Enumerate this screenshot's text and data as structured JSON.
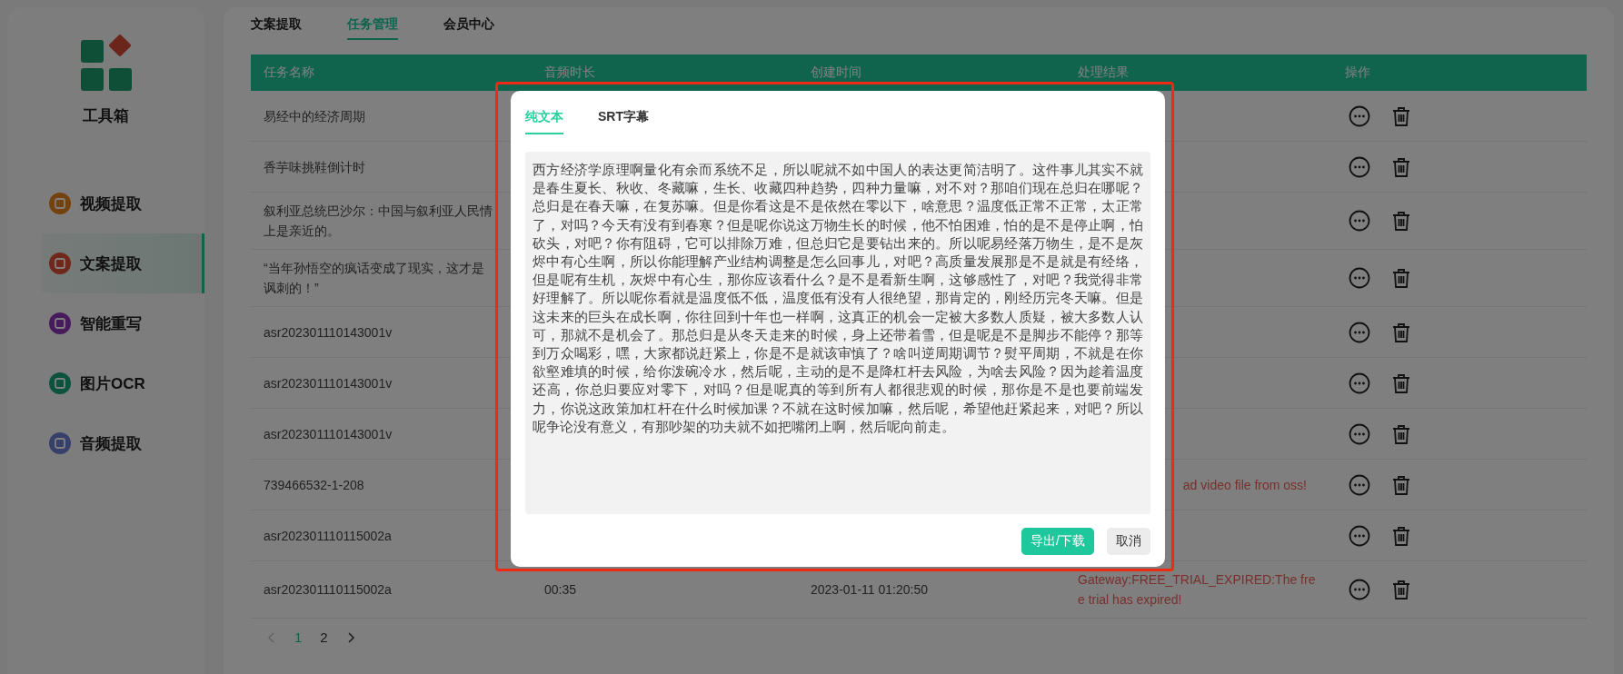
{
  "sidebar": {
    "app_name": "工具箱",
    "items": [
      {
        "label": "视频提取",
        "selected": false,
        "color": "#74420d"
      },
      {
        "label": "文案提取",
        "selected": true,
        "color": "#70281a"
      },
      {
        "label": "智能重写",
        "selected": false,
        "color": "#471a5c"
      },
      {
        "label": "图片OCR",
        "selected": false,
        "color": "#0d523d"
      },
      {
        "label": "音频提取",
        "selected": false,
        "color": "#36406b"
      }
    ]
  },
  "tabs": [
    {
      "label": "文案提取",
      "selected": false
    },
    {
      "label": "任务管理",
      "selected": true
    },
    {
      "label": "会员中心",
      "selected": false
    }
  ],
  "table": {
    "columns": [
      "任务名称",
      "音频时长",
      "创建时间",
      "处理结果",
      "操作"
    ],
    "rows": [
      {
        "name": "易经中的经济周期"
      },
      {
        "name": "香芋味挑鞋倒计时"
      },
      {
        "name": "叙利亚总统巴沙尔：中国与叙利亚人民情上是亲近的。"
      },
      {
        "name": "“当年孙悟空的疯话变成了现实，这才是讽刺的！”"
      },
      {
        "name": "asr202301110143001v"
      },
      {
        "name": "asr202301110143001v"
      },
      {
        "name": "asr202301110143001v"
      },
      {
        "name": "739466532-1-208",
        "result": {
          "text": "ad video file from oss!",
          "kind": "clipped"
        }
      },
      {
        "name": "asr202301110115002a"
      },
      {
        "name": "asr202301110115002a",
        "duration": "00:35",
        "created": "2023-01-11 01:20:50",
        "result": {
          "text": "Gateway:FREE_TRIAL_EXPIRED:The fre\ne trial has expired!",
          "kind": "full"
        }
      }
    ]
  },
  "pagination": {
    "prev_disabled": true,
    "pages": [
      {
        "label": "1",
        "selected": true
      },
      {
        "label": "2",
        "selected": false
      }
    ]
  },
  "modal": {
    "tabs": [
      {
        "label": "纯文本",
        "selected": true
      },
      {
        "label": "SRT字幕",
        "selected": false
      }
    ],
    "text": "西方经济学原理啊量化有余而系统不足，所以呢就不如中国人的表达更简洁明了。这件事儿其实不就是春生夏长、秋收、冬藏嘛，生长、收藏四种趋势，四种力量嘛，对不对？那咱们现在总归在哪呢？总归是在春天嘛，在复苏嘛。但是你看这是不是依然在零以下，啥意思？温度低正常不正常，太正常了，对吗？今天有没有到春寒？但是呢你说这万物生长的时候，他不怕困难，怕的是不是停止啊，怕砍头，对吧？你有阻碍，它可以排除万难，但总归它是要钻出来的。所以呢易经落万物生，是不是灰烬中有心生啊，所以你能理解产业结构调整是怎么回事儿，对吧？高质量发展那是不是就是有经络，但是呢有生机，灰烬中有心生，那你应该看什么？是不是看新生啊，这够感性了，对吧？我觉得非常好理解了。所以呢你看就是温度低不低，温度低有没有人很绝望，那肯定的，刚经历完冬天嘛。但是这未来的巨头在成长啊，你往回到十年也一样啊，这真正的机会一定被大多数人质疑，被大多数人认可，那就不是机会了。那总归是从冬天走来的时候，身上还带着雪，但是呢是不是脚步不能停？那等到万众喝彩，嘿，大家都说赶紧上，你是不是就该审慎了？啥叫逆周期调节？熨平周期，不就是在你欲壑难填的时候，给你泼碗冷水，然后呢，主动的是不是降杠杆去风险，为啥去风险？因为趁着温度还高，你总归要应对零下，对吗？但是呢真的等到所有人都很悲观的时候，那你是不是也要前端发力，你说这政策加杠杆在什么时候加课？不就在这时候加嘛，然后呢，希望他赶紧起来，对吧？所以呢争论没有意义，有那吵架的功夫就不如把嘴闭上啊，然后呢向前走。",
    "buttons": [
      {
        "label": "导出/下载",
        "kind": "primary"
      },
      {
        "label": "取消",
        "kind": "default"
      }
    ]
  }
}
